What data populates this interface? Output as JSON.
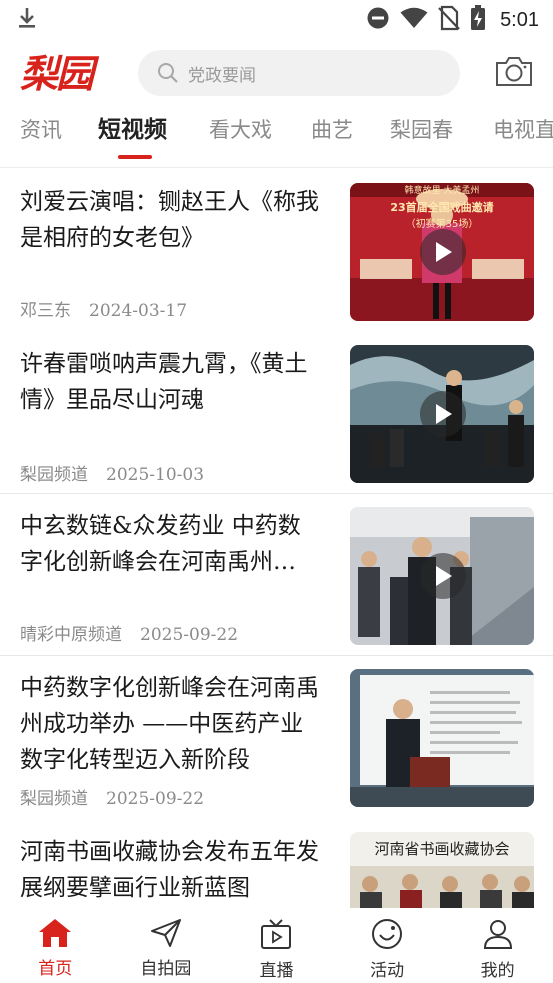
{
  "status_bar": {
    "time": "5:01",
    "icons": [
      "download-icon",
      "dnd-icon",
      "wifi-icon",
      "no-sim-icon",
      "battery-charging-icon"
    ]
  },
  "header": {
    "logo_text": "梨园",
    "search_placeholder": "党政要闻",
    "camera_icon": "camera-icon"
  },
  "tabs": [
    {
      "label": "资讯",
      "active": false
    },
    {
      "label": "短视频",
      "active": true
    },
    {
      "label": "看大戏",
      "active": false
    },
    {
      "label": "曲艺",
      "active": false
    },
    {
      "label": "梨园春",
      "active": false
    },
    {
      "label": "电视直",
      "active": false
    }
  ],
  "news": [
    {
      "title": "刘爱云演唱：铡赵王人《称我是相府的女老包》",
      "source": "邓三东",
      "date": "2024-03-17",
      "has_video": true
    },
    {
      "title": "许春雷唢呐声震九霄，《黄土情》里品尽山河魂",
      "source": "梨园频道",
      "date": "2025-10-03",
      "has_video": true
    },
    {
      "title": "中玄数链&众发药业 中药数字化创新峰会在河南禹州…",
      "source": "晴彩中原频道",
      "date": "2025-09-22",
      "has_video": true
    },
    {
      "title": "中药数字化创新峰会在河南禹州成功举办 ——中医药产业数字化转型迈入新阶段",
      "source": "梨园频道",
      "date": "2025-09-22",
      "has_video": false
    },
    {
      "title": "河南书画收藏协会发布五年发展纲要擘画行业新蓝图",
      "source": "",
      "date": "",
      "has_video": false
    }
  ],
  "thumb_text": {
    "t1_line1": "韩意故里 大美孟州",
    "t1_line2": "23首届全国戏曲邀请",
    "t1_line3": "（初赛第35场）",
    "t5_line1": "河南省书画收藏协会"
  },
  "bottom_nav": [
    {
      "label": "首页",
      "icon": "home-icon",
      "active": true
    },
    {
      "label": "自拍园",
      "icon": "send-icon",
      "active": false
    },
    {
      "label": "直播",
      "icon": "tv-icon",
      "active": false
    },
    {
      "label": "活动",
      "icon": "activity-icon",
      "active": false
    },
    {
      "label": "我的",
      "icon": "user-icon",
      "active": false
    }
  ],
  "colors": {
    "accent": "#d8221c",
    "text": "#1a1a1a",
    "muted": "#8a8a8a"
  }
}
